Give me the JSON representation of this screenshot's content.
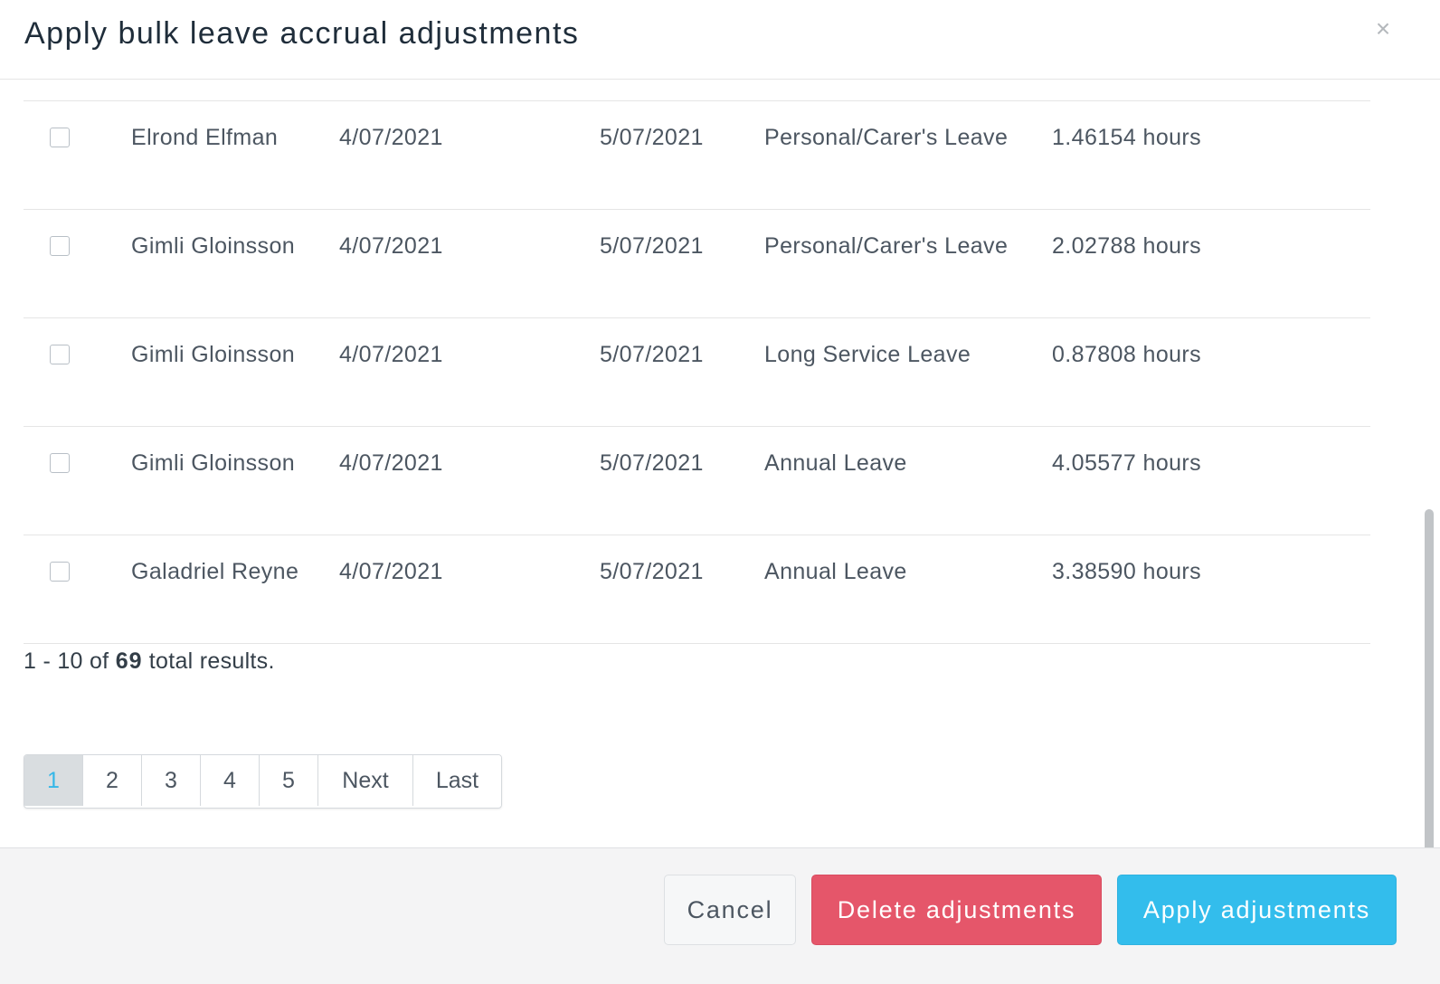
{
  "modal": {
    "title": "Apply bulk leave accrual adjustments",
    "close_glyph": "×"
  },
  "table": {
    "rows": [
      {
        "name": "Elrond Elfman",
        "start": "4/07/2021",
        "end": "5/07/2021",
        "leave_type": "Personal/Carer's Leave",
        "amount": "1.46154 hours",
        "checked": false
      },
      {
        "name": "Gimli Gloinsson",
        "start": "4/07/2021",
        "end": "5/07/2021",
        "leave_type": "Personal/Carer's Leave",
        "amount": "2.02788 hours",
        "checked": false
      },
      {
        "name": "Gimli Gloinsson",
        "start": "4/07/2021",
        "end": "5/07/2021",
        "leave_type": "Long Service Leave",
        "amount": "0.87808 hours",
        "checked": false
      },
      {
        "name": "Gimli Gloinsson",
        "start": "4/07/2021",
        "end": "5/07/2021",
        "leave_type": "Annual Leave",
        "amount": "4.05577 hours",
        "checked": false
      },
      {
        "name": "Galadriel Reyne",
        "start": "4/07/2021",
        "end": "5/07/2021",
        "leave_type": "Annual Leave",
        "amount": "3.38590 hours",
        "checked": false
      }
    ]
  },
  "results": {
    "prefix": "1 - 10 of",
    "total": "69",
    "suffix": "total results."
  },
  "pagination": {
    "pages": [
      "1",
      "2",
      "3",
      "4",
      "5"
    ],
    "active_page": "1",
    "next_label": "Next",
    "last_label": "Last"
  },
  "footer": {
    "cancel_label": "Cancel",
    "delete_label": "Delete adjustments",
    "apply_label": "Apply adjustments"
  },
  "colors": {
    "delete": "#e5566a",
    "apply": "#33bdec",
    "active_page_text": "#35b7e8"
  }
}
